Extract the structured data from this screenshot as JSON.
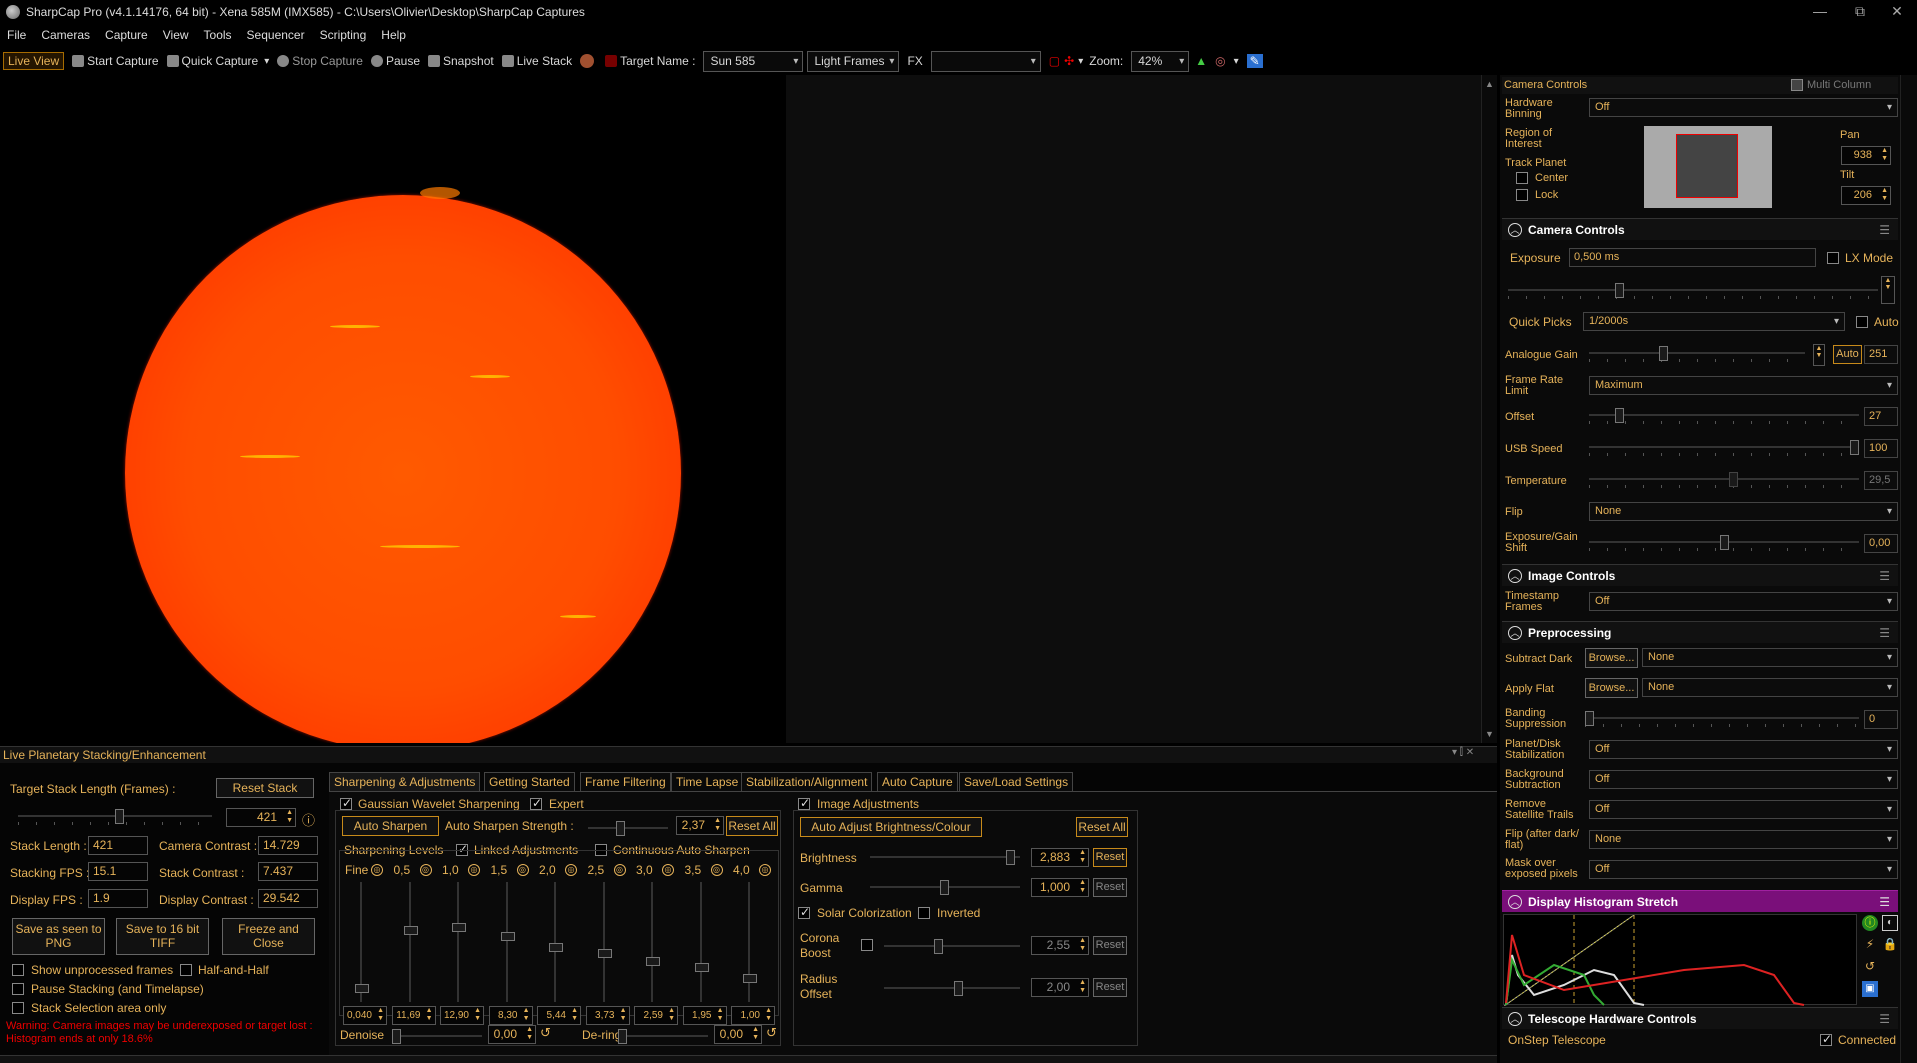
{
  "window": {
    "title": "SharpCap Pro (v4.1.14176, 64 bit) - Xena 585M (IMX585) - C:\\Users\\Olivier\\Desktop\\SharpCap Captures",
    "min": "—",
    "max": "⧉",
    "close": "✕"
  },
  "menu": [
    "File",
    "Cameras",
    "Capture",
    "View",
    "Tools",
    "Sequencer",
    "Scripting",
    "Help"
  ],
  "toolbar": {
    "live_view": "Live View",
    "start_capture": "Start Capture",
    "quick_capture": "Quick Capture",
    "stop_capture": "Stop Capture",
    "pause": "Pause",
    "snapshot": "Snapshot",
    "live_stack": "Live Stack",
    "target_label": "Target Name :",
    "target_value": "Sun 585",
    "frame_type": "Light Frames",
    "fx_label": "FX",
    "zoom_label": "Zoom:",
    "zoom_value": "42%"
  },
  "camera_controls_top": {
    "title": "Camera Controls",
    "multi_column": "Multi Column",
    "hardware_binning_label": "Hardware Binning",
    "hardware_binning_value": "Off",
    "roi_label": "Region of Interest",
    "track_planet_label": "Track Planet",
    "center_label": "Center",
    "lock_label": "Lock",
    "pan_label": "Pan",
    "pan_value": "938",
    "tilt_label": "Tilt",
    "tilt_value": "206"
  },
  "camera_controls": {
    "title": "Camera Controls",
    "exposure_label": "Exposure",
    "exposure_value": "0,500 ms",
    "lx_mode": "LX Mode",
    "quick_picks_label": "Quick Picks",
    "quick_picks_value": "1/2000s",
    "auto_label": "Auto",
    "analogue_gain_label": "Analogue Gain",
    "analogue_gain_auto": "Auto",
    "analogue_gain_value": "251",
    "frame_rate_label": "Frame Rate Limit",
    "frame_rate_value": "Maximum",
    "offset_label": "Offset",
    "offset_value": "27",
    "usb_label": "USB Speed",
    "usb_value": "100",
    "temperature_label": "Temperature",
    "temperature_value": "29,5",
    "flip_label": "Flip",
    "flip_value": "None",
    "expgain_label": "Exposure/Gain Shift",
    "expgain_value": "0,00"
  },
  "image_controls": {
    "title": "Image Controls",
    "timestamp_label": "Timestamp Frames",
    "timestamp_value": "Off"
  },
  "preprocessing": {
    "title": "Preprocessing",
    "subtract_dark_label": "Subtract Dark",
    "browse": "Browse...",
    "subtract_dark_value": "None",
    "apply_flat_label": "Apply Flat",
    "apply_flat_value": "None",
    "banding_label": "Banding Suppression",
    "banding_value": "0",
    "stabilization_label": "Planet/Disk Stabilization",
    "stabilization_value": "Off",
    "background_label": "Background Subtraction",
    "background_value": "Off",
    "satellite_label": "Remove Satellite Trails",
    "satellite_value": "Off",
    "flip_after_label": "Flip (after dark/ flat)",
    "flip_after_value": "None",
    "mask_label": "Mask over exposed pixels",
    "mask_value": "Off"
  },
  "histogram": {
    "title": "Display Histogram Stretch"
  },
  "telescope": {
    "title": "Telescope Hardware Controls",
    "device": "OnStep Telescope",
    "connected": "Connected"
  },
  "stacking": {
    "title": "Live Planetary Stacking/Enhancement",
    "target_len_label": "Target Stack Length (Frames) :",
    "reset_stack": "Reset Stack",
    "target_len_value": "421",
    "stack_length_label": "Stack Length :",
    "stack_length_value": "421",
    "camera_contrast_label": "Camera Contrast :",
    "camera_contrast_value": "14.729",
    "stacking_fps_label": "Stacking FPS :",
    "stacking_fps_value": "15.1",
    "stack_contrast_label": "Stack Contrast :",
    "stack_contrast_value": "7.437",
    "display_fps_label": "Display FPS :",
    "display_fps_value": "1.9",
    "display_contrast_label": "Display Contrast :",
    "display_contrast_value": "29.542",
    "save_png": "Save as seen to PNG",
    "save_tiff": "Save to 16 bit TIFF",
    "freeze": "Freeze and Close",
    "show_unprocessed": "Show unprocessed frames",
    "half_and_half": "Half-and-Half",
    "pause_stacking": "Pause Stacking (and Timelapse)",
    "stack_selection": "Stack Selection area only",
    "warning": "Warning: Camera images may be underexposed or target lost : Histogram ends at only 18.6%"
  },
  "tabs": [
    "Sharpening & Adjustments",
    "Getting Started",
    "Frame Filtering",
    "Time Lapse",
    "Stabilization/Alignment",
    "Auto Capture",
    "Save/Load Settings"
  ],
  "sharpening": {
    "gaussian": "Gaussian Wavelet Sharpening",
    "expert": "Expert",
    "auto_sharpen": "Auto Sharpen",
    "auto_strength_label": "Auto Sharpen Strength :",
    "auto_strength_value": "2,37",
    "reset_all": "Reset All",
    "levels_label": "Sharpening Levels",
    "linked": "Linked Adjustments",
    "continuous": "Continuous Auto Sharpen",
    "levels": [
      {
        "name": "Fine",
        "value": "0,040",
        "pos": 0.92
      },
      {
        "name": "0,5",
        "value": "11,69",
        "pos": 0.4
      },
      {
        "name": "1,0",
        "value": "12,90",
        "pos": 0.37
      },
      {
        "name": "1,5",
        "value": "8,30",
        "pos": 0.45
      },
      {
        "name": "2,0",
        "value": "5,44",
        "pos": 0.55
      },
      {
        "name": "2,5",
        "value": "3,73",
        "pos": 0.6
      },
      {
        "name": "3,0",
        "value": "2,59",
        "pos": 0.68
      },
      {
        "name": "3,5",
        "value": "1,95",
        "pos": 0.73
      },
      {
        "name": "4,0",
        "value": "1,00",
        "pos": 0.83
      }
    ],
    "denoise_label": "Denoise",
    "denoise_value": "0,00",
    "dering_label": "De-ring",
    "dering_value": "0,00"
  },
  "adjustments": {
    "image_adjustments": "Image Adjustments",
    "auto_adjust": "Auto Adjust Brightness/Colour",
    "reset_all": "Reset All",
    "brightness_label": "Brightness",
    "brightness_value": "2,883",
    "gamma_label": "Gamma",
    "gamma_value": "1,000",
    "reset": "Reset",
    "solar_colorization": "Solar Colorization",
    "inverted": "Inverted",
    "corona_label": "Corona Boost",
    "corona_value": "2,55",
    "radius_label": "Radius Offset",
    "radius_value": "2,00"
  }
}
